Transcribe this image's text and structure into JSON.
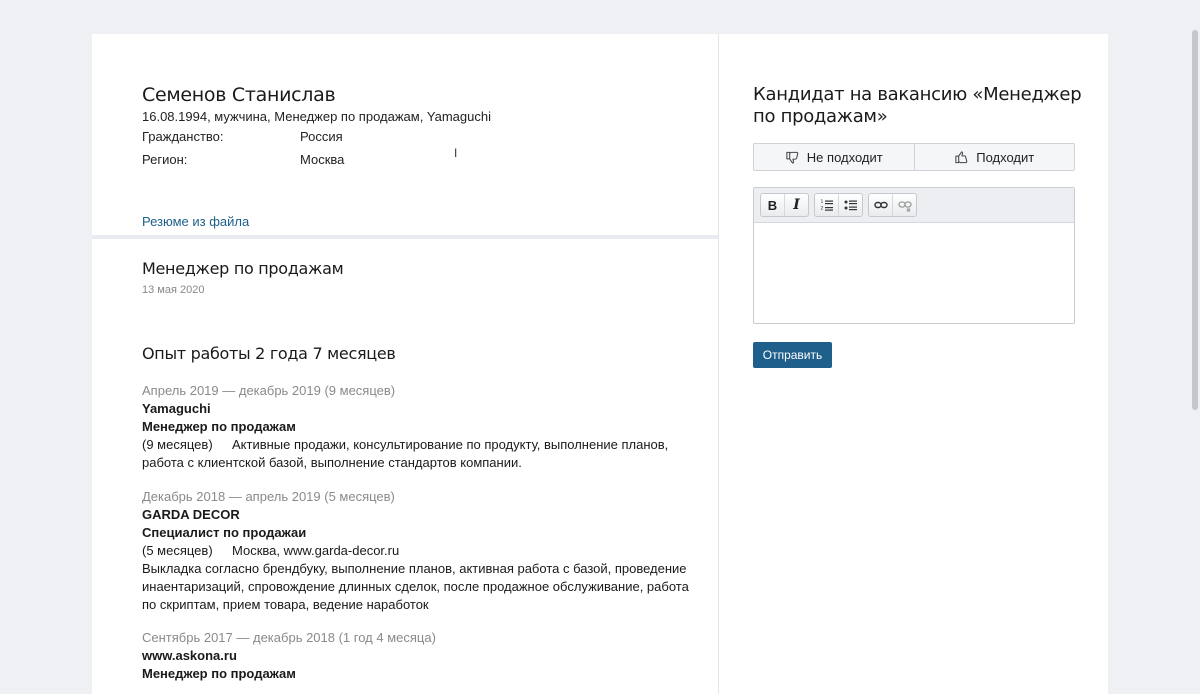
{
  "candidate": {
    "name": "Семенов Станислав",
    "meta": "16.08.1994, мужчина, Менеджер по продажам, Yamaguchi",
    "citizenship_label": "Гражданство:",
    "citizenship_value": "Россия",
    "region_label": "Регион:",
    "region_value": "Москва"
  },
  "tabs": {
    "resume_file": "Резюме из файла"
  },
  "resume": {
    "title": "Менеджер по продажам",
    "date": "13 мая 2020",
    "experience_heading": "Опыт работы 2 года 7 месяцев",
    "jobs": [
      {
        "period": "Апрель 2019 — декабрь 2019 (9 месяцев)",
        "company": "Yamaguchi",
        "position": "Менеджер по продажам",
        "duration": "(9 месяцев)",
        "details": "Активные продажи, консультирование по продукту, выполнение планов, работа с клиентской базой, выполнение стандартов компании."
      },
      {
        "period": "Декабрь 2018 — апрель 2019 (5 месяцев)",
        "company": "GARDA DECOR",
        "position": "Специалист по продажаи",
        "duration": "(5 месяцев)",
        "details": "Москва, www.garda-decor.ru",
        "description": "Выкладка согласно брендбуку, выполнение планов, активная работа с базой, проведение инаентаризаций, спровождение длинных сделок, после продажное обслуживание, работа по скриптам, прием товара, ведение наработок"
      },
      {
        "period": "Сентябрь 2017 — декабрь 2018 (1 год 4 месяца)",
        "company": "www.askona.ru",
        "position": "Менеджер по продажам"
      }
    ]
  },
  "vacancy": {
    "title": "Кандидат на вакансию «Менеджер по продажам»",
    "not_fit_label": "Не подходит",
    "fit_label": "Подходит"
  },
  "editor": {
    "bold_label": "B",
    "italic_label": "I"
  },
  "actions": {
    "send_label": "Отправить"
  },
  "icons": {
    "not_fit": "thumbs-down-icon",
    "fit": "thumbs-up-icon",
    "ordered_list": "ordered-list-icon",
    "unordered_list": "unordered-list-icon",
    "link": "link-icon",
    "unlink": "unlink-icon"
  },
  "colors": {
    "accent": "#1e5f8c",
    "link": "#1d5f8a",
    "page_bg": "#eef0f3",
    "muted_text": "#888888"
  }
}
